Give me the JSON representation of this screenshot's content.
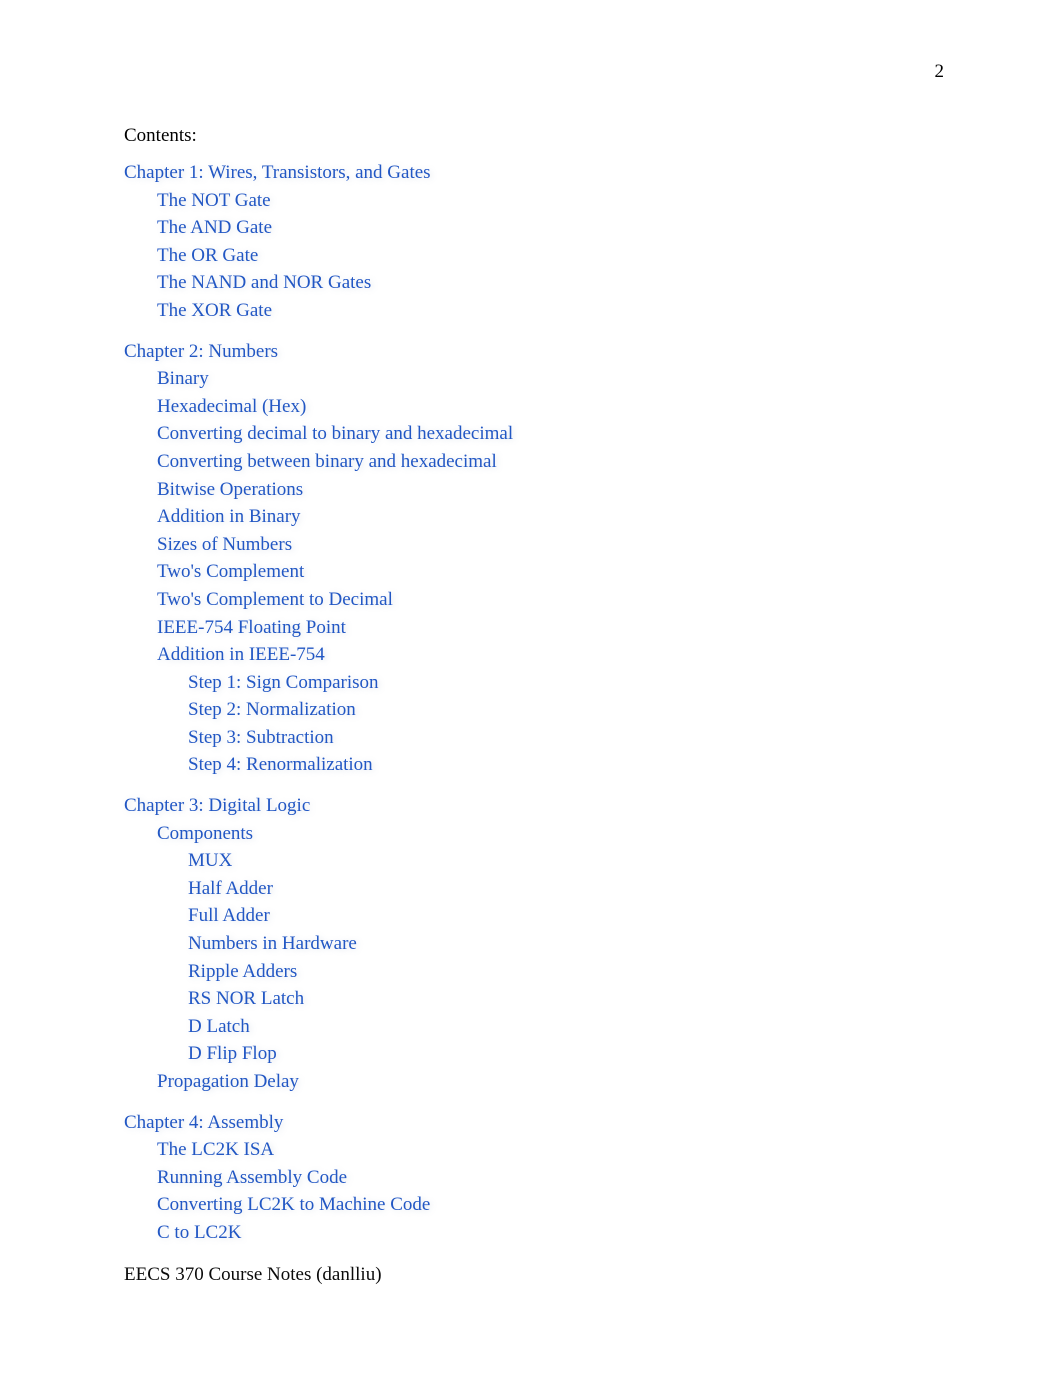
{
  "page": {
    "number": "2",
    "contents_heading": "Contents:",
    "footer": "EECS 370 Course Notes (danlliu)",
    "link_color": "#2257c4",
    "text_color": "#000000",
    "background_color": "#ffffff"
  },
  "toc": [
    {
      "label": "Chapter 1: Wires, Transistors, and Gates",
      "level": 1,
      "chapter_start": false
    },
    {
      "label": "The NOT Gate",
      "level": 2,
      "chapter_start": false
    },
    {
      "label": "The AND Gate",
      "level": 2,
      "chapter_start": false
    },
    {
      "label": "The OR Gate",
      "level": 2,
      "chapter_start": false
    },
    {
      "label": "The NAND and NOR Gates",
      "level": 2,
      "chapter_start": false
    },
    {
      "label": "The XOR Gate",
      "level": 2,
      "chapter_start": false
    },
    {
      "label": "Chapter 2: Numbers",
      "level": 1,
      "chapter_start": true
    },
    {
      "label": "Binary",
      "level": 2,
      "chapter_start": false
    },
    {
      "label": "Hexadecimal (Hex)",
      "level": 2,
      "chapter_start": false
    },
    {
      "label": "Converting decimal to binary and hexadecimal",
      "level": 2,
      "chapter_start": false
    },
    {
      "label": "Converting between binary and hexadecimal",
      "level": 2,
      "chapter_start": false
    },
    {
      "label": "Bitwise Operations",
      "level": 2,
      "chapter_start": false
    },
    {
      "label": "Addition in Binary",
      "level": 2,
      "chapter_start": false
    },
    {
      "label": "Sizes of Numbers",
      "level": 2,
      "chapter_start": false
    },
    {
      "label": "Two's Complement",
      "level": 2,
      "chapter_start": false
    },
    {
      "label": "Two's Complement to Decimal",
      "level": 2,
      "chapter_start": false
    },
    {
      "label": "IEEE-754 Floating Point",
      "level": 2,
      "chapter_start": false
    },
    {
      "label": "Addition in IEEE-754",
      "level": 2,
      "chapter_start": false
    },
    {
      "label": "Step 1: Sign Comparison",
      "level": 3,
      "chapter_start": false
    },
    {
      "label": "Step 2: Normalization",
      "level": 3,
      "chapter_start": false
    },
    {
      "label": "Step 3: Subtraction",
      "level": 3,
      "chapter_start": false
    },
    {
      "label": "Step 4: Renormalization",
      "level": 3,
      "chapter_start": false
    },
    {
      "label": "Chapter 3: Digital Logic",
      "level": 1,
      "chapter_start": true
    },
    {
      "label": "Components",
      "level": 2,
      "chapter_start": false
    },
    {
      "label": "MUX",
      "level": 3,
      "chapter_start": false
    },
    {
      "label": "Half Adder",
      "level": 3,
      "chapter_start": false
    },
    {
      "label": "Full Adder",
      "level": 3,
      "chapter_start": false
    },
    {
      "label": "Numbers in Hardware",
      "level": 3,
      "chapter_start": false
    },
    {
      "label": "Ripple Adders",
      "level": 3,
      "chapter_start": false
    },
    {
      "label": "RS NOR Latch",
      "level": 3,
      "chapter_start": false
    },
    {
      "label": "D Latch",
      "level": 3,
      "chapter_start": false
    },
    {
      "label": "D Flip Flop",
      "level": 3,
      "chapter_start": false
    },
    {
      "label": "Propagation Delay",
      "level": 2,
      "chapter_start": false
    },
    {
      "label": "Chapter 4: Assembly",
      "level": 1,
      "chapter_start": true
    },
    {
      "label": "The LC2K ISA",
      "level": 2,
      "chapter_start": false
    },
    {
      "label": "Running Assembly Code",
      "level": 2,
      "chapter_start": false
    },
    {
      "label": "Converting LC2K to Machine Code",
      "level": 2,
      "chapter_start": false
    },
    {
      "label": "C to LC2K",
      "level": 2,
      "chapter_start": false
    }
  ]
}
